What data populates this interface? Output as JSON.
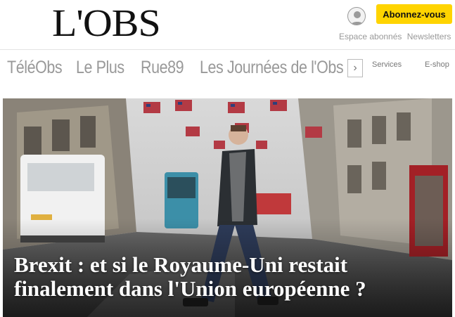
{
  "brand": {
    "logo": "L'OBS"
  },
  "header": {
    "subscribe_label": "Abonnez-vous",
    "links": [
      "Espace abonnés",
      "Newsletters"
    ],
    "accent": "#ffd400"
  },
  "nav": {
    "items": [
      "TéléObs",
      "Le Plus",
      "Rue89",
      "Les Journées de l'Obs"
    ],
    "arrow": "›",
    "secondary": [
      "Services",
      "E-shop"
    ]
  },
  "hero": {
    "headline": "Brexit : et si le Royaume-Uni restait finalement dans l'Union européenne ?",
    "image_icon": "street-photo"
  }
}
